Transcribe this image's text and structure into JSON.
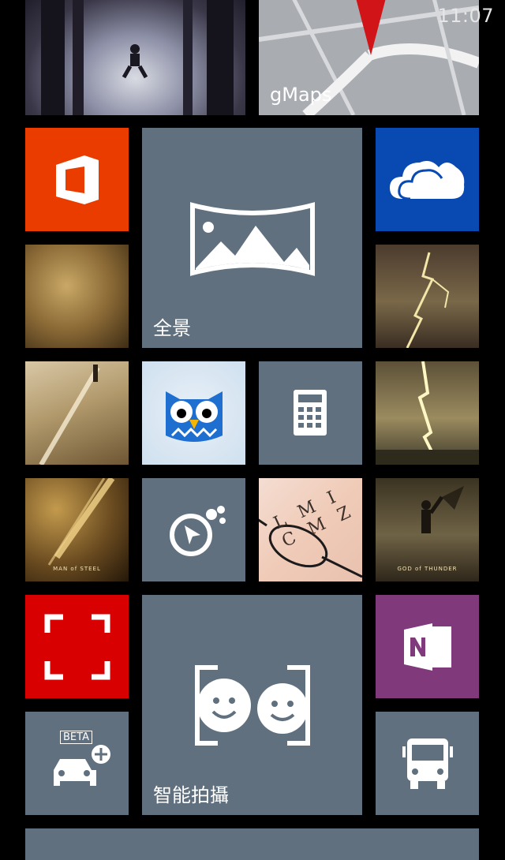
{
  "status": {
    "time": "11:07"
  },
  "tiles": {
    "gmaps": {
      "label": "gMaps"
    },
    "panorama": {
      "label": "全景"
    },
    "smart_shoot": {
      "label": "智能拍攝"
    },
    "car_beta": {
      "badge": "BETA"
    },
    "man_of_steel": {
      "credit": "MAN of STEEL"
    },
    "god_of_thunder": {
      "credit": "GOD of THUNDER"
    },
    "glasses": {
      "letters": "L M I C M Z"
    }
  },
  "colors": {
    "office": "#eb3c00",
    "onedrive": "#094ab2",
    "scanner_red": "#d80000",
    "onenote": "#80397b",
    "slate": "#60707f"
  }
}
